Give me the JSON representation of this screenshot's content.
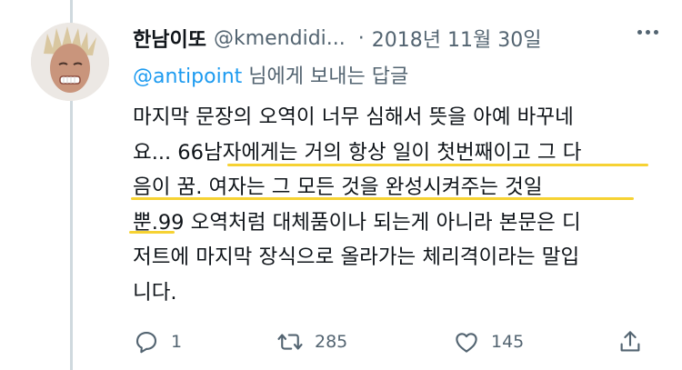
{
  "tweet": {
    "display_name": "한남이또",
    "handle": "@kmendidi...",
    "separator": "·",
    "date": "2018년 11월 30일",
    "reply_to_handle": "@antipoint",
    "reply_to_suffix": " 님에게 보내는 답글",
    "body_lines": [
      "마지막 문장의 오역이 너무 심해서 뜻을 아예 바꾸네",
      "요... 66남자에게는 거의 항상 일이 첫번째이고 그 다",
      "음이 꿈. 여자는 그 모든 것을 완성시켜주는 것일",
      "뿐.99 오역처럼 대체품이나 되는게 아니라 본문은 디",
      "저트에 마지막 장식으로 올라가는 체리격이라는 말입",
      "니다."
    ]
  },
  "actions": {
    "reply_count": "1",
    "retweet_count": "285",
    "like_count": "145"
  },
  "colors": {
    "highlight": "#f6d233",
    "link": "#1d9bf0",
    "muted": "#536471",
    "thread_line": "#cfd9de"
  },
  "icons": [
    "more-icon",
    "reply-icon",
    "retweet-icon",
    "like-icon",
    "share-icon"
  ]
}
